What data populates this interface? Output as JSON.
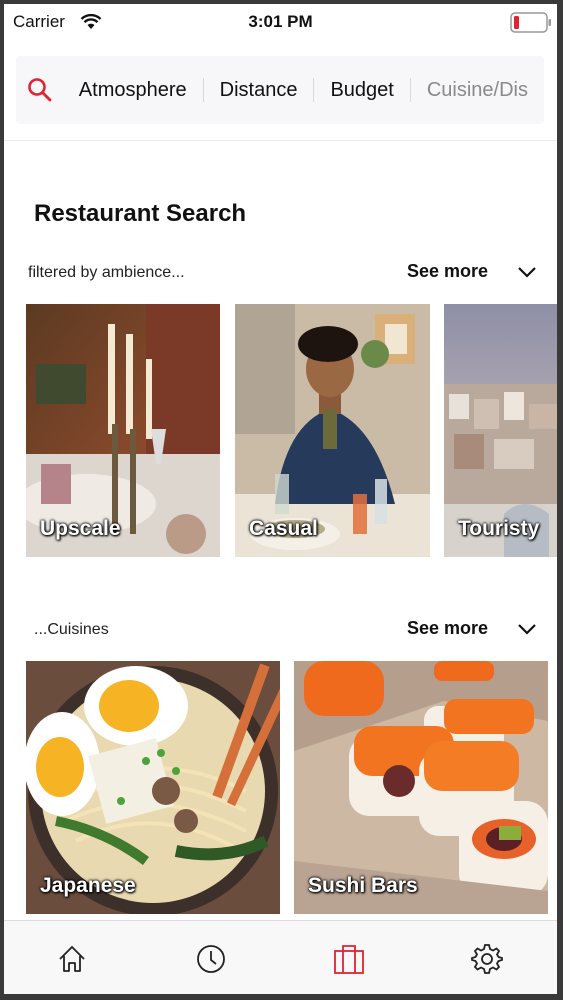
{
  "status_bar": {
    "carrier": "Carrier",
    "time": "3:01 PM"
  },
  "filters": {
    "search_icon": "search-icon",
    "items": [
      "Atmosphere",
      "Distance",
      "Budget",
      "Cuisine/Dis"
    ]
  },
  "page_title": "Restaurant Search",
  "ambience_section": {
    "label": "filtered by ambience...",
    "see_more": "See more",
    "cards": [
      "Upscale",
      "Casual",
      "Touristy"
    ]
  },
  "cuisine_section": {
    "label": "...Cuisines",
    "see_more": "See more",
    "cards": [
      "Japanese",
      "Sushi Bars"
    ]
  },
  "tab_bar": {
    "icons": [
      "home-icon",
      "clock-icon",
      "shopping-bag-icon",
      "gear-icon"
    ],
    "active_color": "#e0242f",
    "icon_color": "#222222"
  },
  "colors": {
    "accent": "#e0242f"
  }
}
